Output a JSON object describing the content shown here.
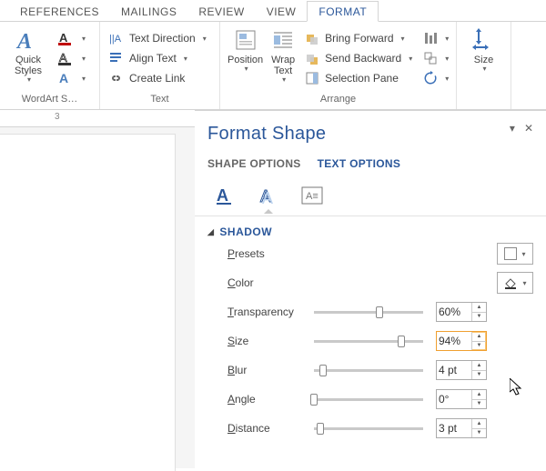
{
  "tabs": {
    "references": "REFERENCES",
    "mailings": "MAILINGS",
    "review": "REVIEW",
    "view": "VIEW",
    "format": "FORMAT"
  },
  "ribbon": {
    "wordart": {
      "quick_styles": "Quick Styles",
      "group": "WordArt S…"
    },
    "text": {
      "text_direction": "Text Direction",
      "align_text": "Align Text",
      "create_link": "Create Link",
      "group": "Text"
    },
    "arrange": {
      "position": "Position",
      "wrap_text": "Wrap Text",
      "bring_forward": "Bring Forward",
      "send_backward": "Send Backward",
      "selection_pane": "Selection Pane",
      "group": "Arrange"
    },
    "size": {
      "size": "Size",
      "group": ""
    }
  },
  "ruler": {
    "mark": "3"
  },
  "panel": {
    "title": "Format Shape",
    "subtabs": {
      "shape": "SHAPE OPTIONS",
      "text": "TEXT OPTIONS"
    },
    "section": "SHADOW",
    "fields": {
      "presets": {
        "label_u": "P",
        "label_rest": "resets"
      },
      "color": {
        "label_u": "C",
        "label_rest": "olor"
      },
      "transparency": {
        "label_u": "T",
        "label_rest": "ransparency",
        "value": "60%",
        "pct": 60
      },
      "size": {
        "label_u": "S",
        "label_rest": "ize",
        "value": "94%",
        "pct": 80
      },
      "blur": {
        "label_u": "B",
        "label_rest": "lur",
        "value": "4 pt",
        "pct": 8
      },
      "angle": {
        "label_u": "A",
        "label_rest": "ngle",
        "value": "0°",
        "pct": 0
      },
      "distance": {
        "label_u": "D",
        "label_rest": "istance",
        "value": "3 pt",
        "pct": 6
      }
    }
  }
}
